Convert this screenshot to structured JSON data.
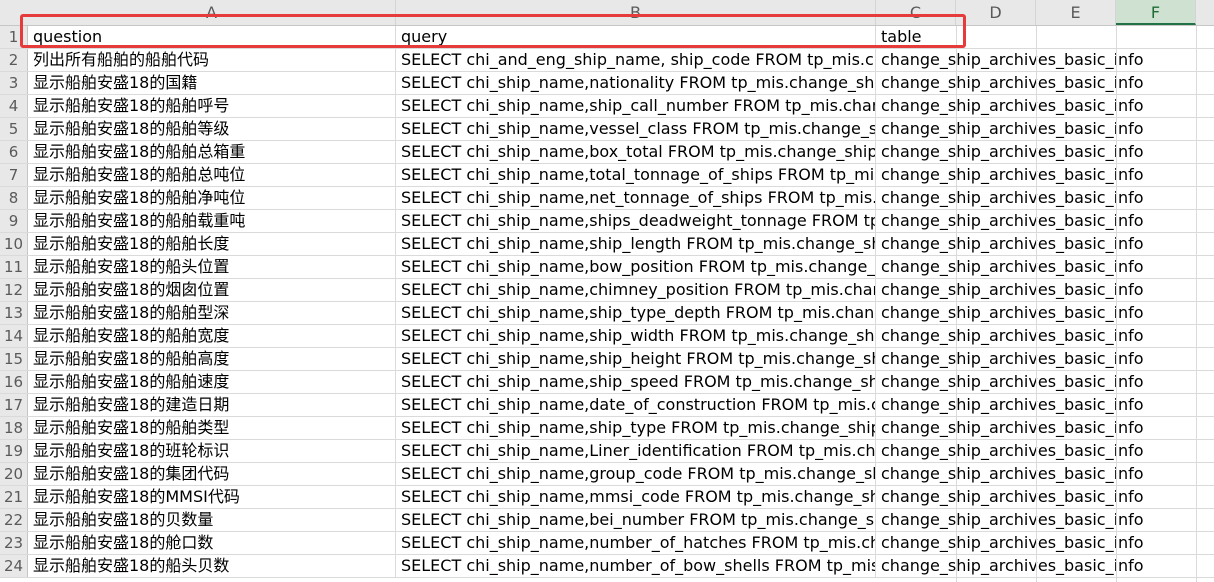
{
  "columns": [
    "A",
    "B",
    "C",
    "D",
    "E",
    "F"
  ],
  "selected_column": "F",
  "rows": [
    {
      "n": "1",
      "a": "question",
      "b": "query",
      "c": "table"
    },
    {
      "n": "2",
      "a": "列出所有船舶的船舶代码",
      "b": "SELECT chi_and_eng_ship_name, ship_code FROM tp_mis.chan",
      "c": "change_ship_archives_basic_info"
    },
    {
      "n": "3",
      "a": "显示船舶安盛18的国籍",
      "b": "SELECT chi_ship_name,nationality  FROM tp_mis.change_ship_a",
      "c": "change_ship_archives_basic_info"
    },
    {
      "n": "4",
      "a": "显示船舶安盛18的船舶呼号",
      "b": "SELECT chi_ship_name,ship_call_number  FROM tp_mis.change",
      "c": "change_ship_archives_basic_info"
    },
    {
      "n": "5",
      "a": "显示船舶安盛18的船舶等级",
      "b": "SELECT chi_ship_name,vessel_class FROM tp_mis.change_ship_a",
      "c": "change_ship_archives_basic_info"
    },
    {
      "n": "6",
      "a": "显示船舶安盛18的船舶总箱重",
      "b": "SELECT chi_ship_name,box_total FROM tp_mis.change_ship_arc",
      "c": "change_ship_archives_basic_info"
    },
    {
      "n": "7",
      "a": "显示船舶安盛18的船舶总吨位",
      "b": "SELECT chi_ship_name,total_tonnage_of_ships FROM tp_mis.ch",
      "c": "change_ship_archives_basic_info"
    },
    {
      "n": "8",
      "a": "显示船舶安盛18的船舶净吨位",
      "b": "SELECT chi_ship_name,net_tonnage_of_ships FROM tp_mis.cha",
      "c": "change_ship_archives_basic_info"
    },
    {
      "n": "9",
      "a": "显示船舶安盛18的船舶载重吨",
      "b": "SELECT chi_ship_name,ships_deadweight_tonnage FROM tp_m",
      "c": "change_ship_archives_basic_info"
    },
    {
      "n": "10",
      "a": "显示船舶安盛18的船舶长度",
      "b": "SELECT chi_ship_name,ship_length FROM tp_mis.change_ship_",
      "c": "change_ship_archives_basic_info"
    },
    {
      "n": "11",
      "a": "显示船舶安盛18的船头位置",
      "b": "SELECT chi_ship_name,bow_position FROM tp_mis.change_ship",
      "c": "change_ship_archives_basic_info"
    },
    {
      "n": "12",
      "a": "显示船舶安盛18的烟囱位置",
      "b": "SELECT chi_ship_name,chimney_position FROM tp_mis.change",
      "c": "change_ship_archives_basic_info"
    },
    {
      "n": "13",
      "a": "显示船舶安盛18的船舶型深",
      "b": "SELECT chi_ship_name,ship_type_depth FROM tp_mis.change_s",
      "c": "change_ship_archives_basic_info"
    },
    {
      "n": "14",
      "a": "显示船舶安盛18的船舶宽度",
      "b": "SELECT chi_ship_name,ship_width FROM tp_mis.change_ship_a",
      "c": "change_ship_archives_basic_info"
    },
    {
      "n": "15",
      "a": "显示船舶安盛18的船舶高度",
      "b": "SELECT chi_ship_name,ship_height FROM tp_mis.change_ship_",
      "c": "change_ship_archives_basic_info"
    },
    {
      "n": "16",
      "a": "显示船舶安盛18的船舶速度",
      "b": "SELECT chi_ship_name,ship_speed FROM tp_mis.change_ship_a",
      "c": "change_ship_archives_basic_info"
    },
    {
      "n": "17",
      "a": "显示船舶安盛18的建造日期",
      "b": "SELECT chi_ship_name,date_of_construction FROM tp_mis.chan",
      "c": "change_ship_archives_basic_info"
    },
    {
      "n": "18",
      "a": "显示船舶安盛18的船舶类型",
      "b": "SELECT chi_ship_name,ship_type FROM tp_mis.change_ship_arc",
      "c": "change_ship_archives_basic_info"
    },
    {
      "n": "19",
      "a": "显示船舶安盛18的班轮标识",
      "b": "SELECT chi_ship_name,Liner_identification FROM tp_mis.chang",
      "c": "change_ship_archives_basic_info"
    },
    {
      "n": "20",
      "a": "显示船舶安盛18的集团代码",
      "b": "SELECT chi_ship_name,group_code FROM tp_mis.change_ship_a",
      "c": "change_ship_archives_basic_info"
    },
    {
      "n": "21",
      "a": "显示船舶安盛18的MMSI代码",
      "b": "SELECT chi_ship_name,mmsi_code FROM tp_mis.change_ship_a",
      "c": "change_ship_archives_basic_info"
    },
    {
      "n": "22",
      "a": "显示船舶安盛18的贝数量",
      "b": "SELECT chi_ship_name,bei_number FROM tp_mis.change_ship_",
      "c": "change_ship_archives_basic_info"
    },
    {
      "n": "23",
      "a": "显示船舶安盛18的舱口数",
      "b": "SELECT chi_ship_name,number_of_hatches FROM tp_mis.chang",
      "c": "change_ship_archives_basic_info"
    },
    {
      "n": "24",
      "a": "显示船舶安盛18的船头贝数",
      "b": "SELECT chi_ship_name,number_of_bow_shells FROM tp_mis.ch",
      "c": "change_ship_archives_basic_info"
    }
  ]
}
